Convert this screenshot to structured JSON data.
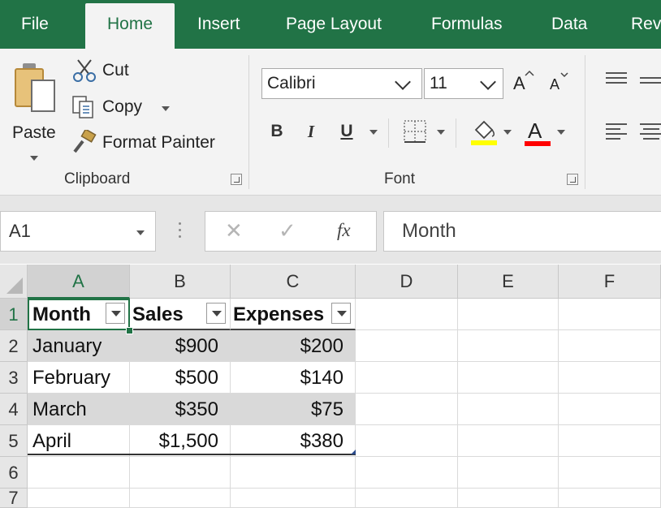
{
  "tabs": [
    "File",
    "Home",
    "Insert",
    "Page Layout",
    "Formulas",
    "Data",
    "Rev"
  ],
  "active_tab": "Home",
  "accent_color": "#217346",
  "ribbon": {
    "clipboard": {
      "paste_label": "Paste",
      "cut_label": "Cut",
      "copy_label": "Copy",
      "format_painter_label": "Format Painter",
      "group_label": "Clipboard"
    },
    "font": {
      "font_name": "Calibri",
      "font_size": "11",
      "grow_label": "A",
      "shrink_label": "A",
      "bold_label": "B",
      "italic_label": "I",
      "underline_label": "U",
      "font_color_label": "A",
      "fill_color": "#ffff00",
      "font_color": "#ff0000",
      "group_label": "Font"
    }
  },
  "formula_bar": {
    "name_box": "A1",
    "cancel_glyph": "✕",
    "enter_glyph": "✓",
    "fx_label": "fx",
    "value": "Month"
  },
  "grid": {
    "columns": [
      "A",
      "B",
      "C",
      "D",
      "E",
      "F"
    ],
    "rows": [
      "1",
      "2",
      "3",
      "4",
      "5",
      "6",
      "7"
    ],
    "table": {
      "headers": [
        "Month",
        "Sales",
        "Expenses"
      ],
      "rows": [
        [
          "January",
          "$900",
          "$200"
        ],
        [
          "February",
          "$500",
          "$140"
        ],
        [
          "March",
          "$350",
          "$75"
        ],
        [
          "April",
          "$1,500",
          "$380"
        ]
      ]
    },
    "band_color": "#d9d9d9"
  }
}
